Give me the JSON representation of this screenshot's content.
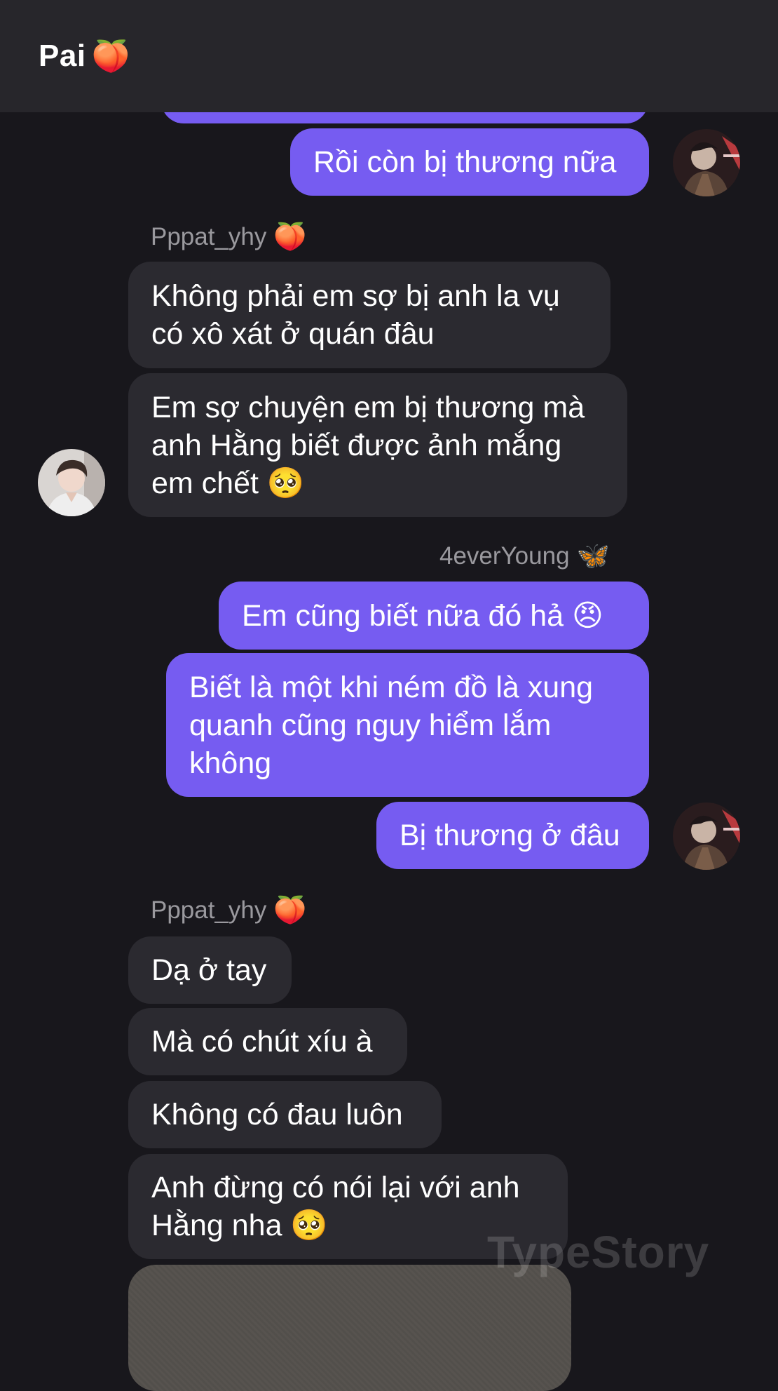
{
  "header": {
    "title": "Pai",
    "title_emoji": "🍑"
  },
  "messages": {
    "m0": "Rồi còn bị thương nữa",
    "s1": {
      "name": "Pppat_yhy",
      "emoji": "🍑"
    },
    "m1": "Không phải em sợ bị anh la vụ\ncó xô xát ở quán đâu",
    "m2": "Em sợ chuyện em bị thương mà\nanh Hằng biết được ảnh mắng\nem chết 🥺",
    "s2": {
      "name": "4everYoung",
      "emoji": "🦋"
    },
    "m3": "Em cũng biết nữa đó hả 😠",
    "m4": "Biết là một khi ném đồ là xung\nquanh cũng nguy hiểm lắm\nkhông",
    "m5": "Bị thương ở đâu",
    "s3": {
      "name": "Pppat_yhy",
      "emoji": "🍑"
    },
    "m6": "Dạ ở tay",
    "m7": "Mà có chút xíu à",
    "m8": "Không có đau luôn",
    "m9": "Anh đừng có nói lại với anh\nHằng nha 🥺"
  },
  "watermark": "TypeStory",
  "colors": {
    "mine": "#765cf1",
    "theirs": "#2b2a30",
    "background": "#18171c",
    "header": "#27262b"
  },
  "icons": [
    "avatar-4everyoung",
    "avatar-pppat"
  ]
}
